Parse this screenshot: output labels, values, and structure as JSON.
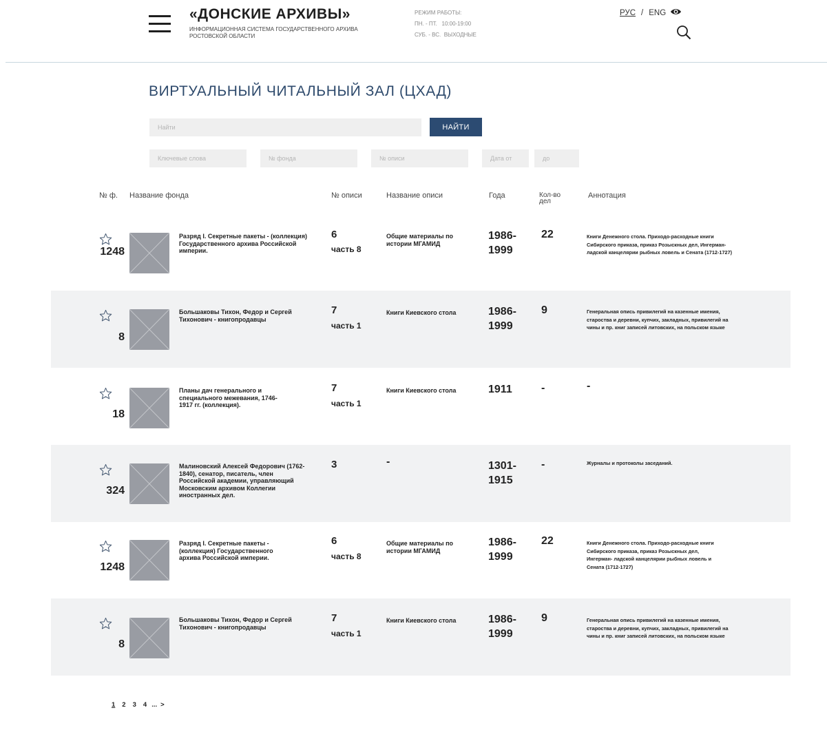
{
  "header": {
    "title": "«ДОНСКИЕ АРХИВЫ»",
    "subtitle_line1": "ИНФОРМАЦИОННАЯ СИСТЕМА ГОСУДАРСТВЕННОГО АРХИВА",
    "subtitle_line2": "РОСТОВСКОЙ ОБЛАСТИ",
    "hours_label": "РЕЖИМ РАБОТЫ:",
    "hours_weekdays": "ПН. - ПТ.   10:00-19:00",
    "hours_weekend": "СУБ. - ВС.  ВЫХОДНЫЕ",
    "lang_ru": "РУС",
    "lang_sep": "/",
    "lang_en": "ENG"
  },
  "page_title": "ВИРТУАЛЬНЫЙ ЧИТАЛЬНЫЙ ЗАЛ (ЦХАД)",
  "search": {
    "placeholder": "Найти",
    "button": "НАЙТИ",
    "keywords_placeholder": "Ключевые слова",
    "fond_placeholder": "№ фонда",
    "opis_placeholder": "№ описи",
    "date_from_placeholder": "Дата от",
    "date_to_placeholder": "до"
  },
  "columns": {
    "fond_no": "№ ф.",
    "fond_name": "Название фонда",
    "opis_no": "№ описи",
    "opis_name": "Название описи",
    "years": "Года",
    "count_line1": "Кол-во",
    "count_line2": "дел",
    "annotation": "Аннотация"
  },
  "rows": [
    {
      "fond": "1248",
      "name": "Разряд I. Секретные пакеты - (коллекция) Государственного архива Российской империи.",
      "opis": "6",
      "part": "часть 8",
      "opis_name": "Общие материалы по истории МГАМИД",
      "years": "1986-1999",
      "count": "22",
      "annotation": "Книги Денежного стола. Приходо-расходные книги Сибирского приказа, приказ Розыскных дел, Ингерман- ладской канцелярии рыбных ловель и Сената (1712-1727)"
    },
    {
      "fond": "8",
      "name": "Большаковы Тихон, Федор и Сергей Тихонович - книгопродавцы",
      "opis": "7",
      "part": "часть 1",
      "opis_name": "Книги Киевского стола",
      "years": "1986-1999",
      "count": "9",
      "annotation": "Генеральная опись привилегий на казенные имения, староства и деревни, купчих, закладных, привилегий на чины и пр. книг записей литовских, на польском языке"
    },
    {
      "fond": "18",
      "name": "Планы дач генерального и специального межевания, 1746-1917 гг. (коллекция).",
      "opis": "7",
      "part": "часть 1",
      "opis_name": "Книги Киевского стола",
      "years": "1911",
      "count": "-",
      "annotation": "-"
    },
    {
      "fond": "324",
      "name": "Малиновский Алексей Федорович (1762-1840), сенатор, писатель, член Российской академии, управляющий Московским архивом Коллегии иностранных дел.",
      "opis": "3",
      "part": "",
      "opis_name": "-",
      "years": "1301-1915",
      "count": "-",
      "annotation": "Журналы и протоколы заседаний."
    },
    {
      "fond": "1248",
      "name": "Разряд I. Секретные пакеты - (коллекция) Государственного архива Российской империи.",
      "opis": "6",
      "part": "часть 8",
      "opis_name": "Общие материалы по истории МГАМИД",
      "years": "1986-1999",
      "count": "22",
      "annotation": "Книги Денежного стола. Приходо-расходные книги Сибирского приказа, приказ Розыскных дел, Ингерман- ладской канцелярии рыбных ловель и Сената (1712-1727)"
    },
    {
      "fond": "8",
      "name": "Большаковы Тихон, Федор и Сергей Тихонович - книгопродавцы",
      "opis": "7",
      "part": "часть 1",
      "opis_name": "Книги Киевского стола",
      "years": "1986-1999",
      "count": "9",
      "annotation": "Генеральная опись привилегий на казенные имения, староства и деревни, купчих, закладных, привилегий на чины и пр. книг записей литовских, на польском языке"
    }
  ],
  "pagination": {
    "pages": [
      "1",
      "2",
      "3",
      "4"
    ],
    "ellipsis": "...",
    "next": ">"
  },
  "icons": {
    "menu": "hamburger-icon",
    "search": "search-icon",
    "accessibility": "eye-icon",
    "favorite": "star-outline-icon",
    "thumbnail": "image-placeholder-icon"
  },
  "colors": {
    "title": "#2e4a6c",
    "button": "#2c4b72",
    "row_shade": "#f1f2f3",
    "thumb": "#999ca3"
  }
}
